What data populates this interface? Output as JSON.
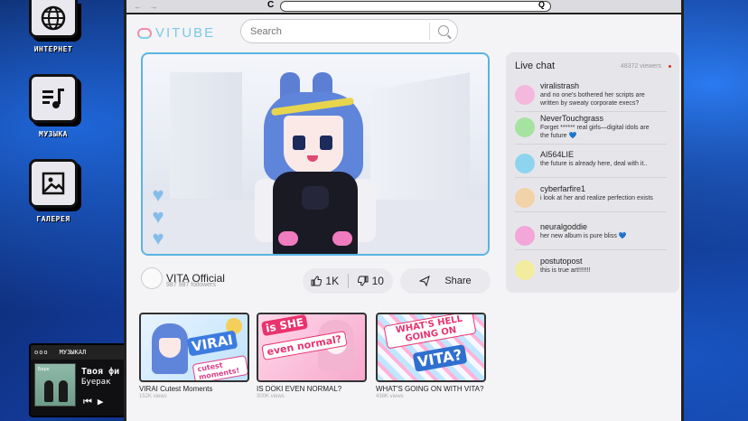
{
  "desktop": {
    "icons": [
      {
        "label": "ИНТЕРНЕТ",
        "icon": "globe-icon"
      },
      {
        "label": "МУЗЫКА",
        "icon": "music-list-icon"
      },
      {
        "label": "ГАЛЕРЕЯ",
        "icon": "image-icon"
      }
    ]
  },
  "player": {
    "dots": "ooo",
    "title": "МУЗЫКАЛ",
    "cover_caption": "Берк",
    "song": "Твоя фи",
    "artist": "Буерак",
    "prev": "⏮",
    "play": "▶"
  },
  "browser": {
    "back_forward": "← →",
    "reload": "C",
    "search_glyph": "Q"
  },
  "site": {
    "logo": "VITUBE",
    "search_placeholder": "Search"
  },
  "channel": {
    "name": "VITA Official",
    "followers": "987 987 followers"
  },
  "actions": {
    "likes": "1K",
    "dislikes": "10",
    "share": "Share"
  },
  "chat": {
    "title": "Live chat",
    "viewers": "48372 viewers",
    "messages": [
      {
        "user": "viralistrash",
        "text": "and no one's bothered her scripts are written by sweaty corporate execs?",
        "color": "#f4b8dc"
      },
      {
        "user": "NeverTouchgrass",
        "text": "Forget ****** real girls—digital idols are the future 💙",
        "color": "#a6e3a0"
      },
      {
        "user": "AI564LIE",
        "text": "the future is already here, deal with it..",
        "color": "#8fd4ef"
      },
      {
        "user": "cyberfarfire1",
        "text": "i look at her and realize perfection exists",
        "color": "#f2d2a8"
      },
      {
        "user": "neuralgoddie",
        "text": "her new album is pure bliss 💙",
        "color": "#f3a6d8"
      },
      {
        "user": "postutopost",
        "text": "this is true art!!!!!!!",
        "color": "#f2ec9e"
      }
    ]
  },
  "videos": [
    {
      "title": "VIRAI Cutest Moments",
      "views": "152K views",
      "sticker1": "VIRAI",
      "sticker2": "cutest moments!"
    },
    {
      "title": "IS DOKI EVEN NORMAL?",
      "views": "300K views",
      "sticker1": "is SHE",
      "sticker2": "even normal?"
    },
    {
      "title": "WHAT'S GOING ON WITH VITA?",
      "views": "438K views",
      "sticker1": "WHAT'S HELL GOING ON",
      "sticker2": "VITA?"
    }
  ],
  "colors": {
    "accent": "#5ab4e2",
    "logo": "#7ac8e6",
    "heart": "#7ab8ea",
    "live": "#e02a2a"
  }
}
